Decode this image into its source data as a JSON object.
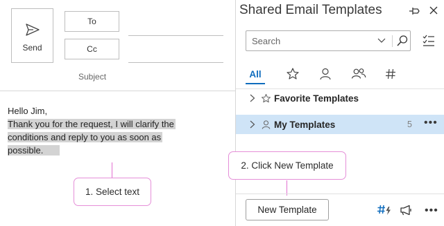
{
  "compose": {
    "send_label": "Send",
    "to_label": "To",
    "cc_label": "Cc",
    "subject_label": "Subject",
    "body_lines": [
      "Hello Jim,",
      "Thank you for the request, I will clarify the",
      "conditions and reply to you as soon as",
      "possible."
    ]
  },
  "pane": {
    "title": "Shared Email Templates",
    "search_placeholder": "Search",
    "tabs": [
      {
        "label": "All",
        "icon": "",
        "selected": true
      },
      {
        "label": "",
        "icon": "star-icon"
      },
      {
        "label": "",
        "icon": "person-icon"
      },
      {
        "label": "",
        "icon": "people-icon"
      },
      {
        "label": "",
        "icon": "hash-icon"
      }
    ],
    "tree": [
      {
        "label": "Favorite Templates",
        "icon": "star-icon",
        "count": ""
      },
      {
        "label": "My Templates",
        "icon": "person-icon",
        "count": "5",
        "selected": true
      }
    ],
    "new_template_label": "New Template",
    "accent_color": "#0f6cbd",
    "selected_row_color": "#cfe4f7"
  },
  "callouts": {
    "step1": "1. Select text",
    "step2": "2. Click New Template",
    "border_color": "#e58ed8"
  }
}
